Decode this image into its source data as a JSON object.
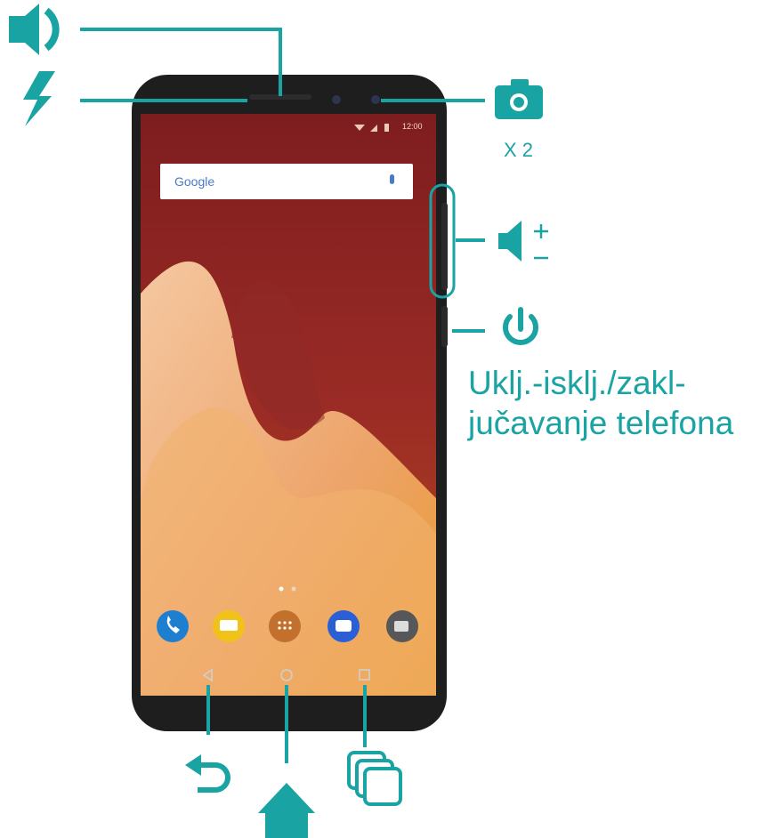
{
  "colors": {
    "accent": "#1aa3a3",
    "phone_body": "#1e1e1f",
    "screen_top": "#8e2324",
    "screen_wave": "#efb27a",
    "nav_icons": "#cfcfcf"
  },
  "labels": {
    "camera_count": "X 2",
    "power_line1": "Uklj.-isklj./zakl-",
    "power_line2": "jučavanje telefona"
  },
  "phone_screen": {
    "search_brand": "Google",
    "status_time": "12:00"
  },
  "icons": {
    "earpiece": "speaker-icon",
    "flash": "flash-icon",
    "camera": "camera-icon",
    "volume": "volume-plus-minus-icon",
    "power": "power-icon",
    "back": "back-arrow-icon",
    "home": "home-icon",
    "recent": "recent-apps-icon"
  }
}
